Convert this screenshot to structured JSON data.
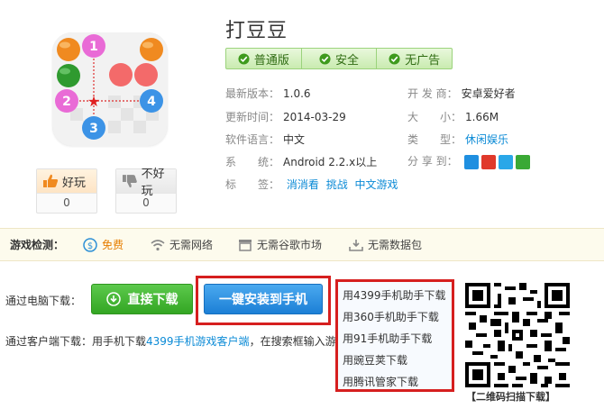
{
  "app": {
    "title": "打豆豆",
    "icon_name": "dadoudou-game-icon"
  },
  "badges": [
    {
      "label": "普通版"
    },
    {
      "label": "安全"
    },
    {
      "label": "无广告"
    }
  ],
  "info": {
    "version_label": "最新版本：",
    "version": "1.0.6",
    "developer_label": "开 发 商：",
    "developer": "安卓爱好者",
    "updated_label": "更新时间：",
    "updated": "2014-03-29",
    "size_label": "大　　小：",
    "size": "1.66M",
    "language_label": "软件语言：",
    "language": "中文",
    "category_label": "类　　型：",
    "category": "休闲娱乐",
    "system_label": "系　　统：",
    "system": "Android 2.2.x以上",
    "share_label": "分 享 到：",
    "tags_label": "标　　签：",
    "tags": [
      "消消看",
      "挑战",
      "中文游戏"
    ]
  },
  "votes": {
    "like_label": "好玩",
    "like_count": "0",
    "dislike_label": "不好玩",
    "dislike_count": "0"
  },
  "detect": {
    "label": "游戏检测：",
    "items": [
      "免费",
      "无需网络",
      "无需谷歌市场",
      "无需数据包"
    ]
  },
  "download": {
    "pc_label": "通过电脑下载：",
    "direct_label": "直接下载",
    "install_label": "一键安装到手机",
    "client_prefix": "通过客户端下载：用手机下载",
    "client_link": "4399手机游戏客户端",
    "client_suffix": "，在搜索框输入游戏"
  },
  "helpers": [
    "用4399手机助手下载",
    "用360手机助手下载",
    "用91手机助手下载",
    "用豌豆荚下载",
    "用腾讯管家下载"
  ],
  "qr_caption": "【二维码扫描下载】",
  "colors": {
    "accent_green": "#33a623",
    "accent_blue": "#1c7fd6",
    "highlight_red": "#d61f1f",
    "link_blue": "#0a8ad6"
  }
}
